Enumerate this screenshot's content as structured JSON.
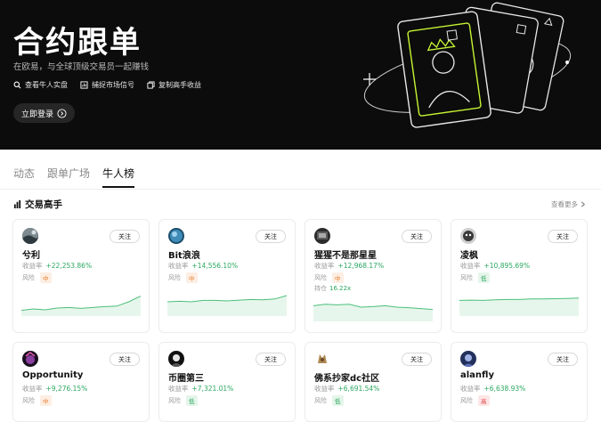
{
  "hero": {
    "title": "合约跟单",
    "subtitle": "在欧易，与全球顶级交易员一起赚钱",
    "features": [
      {
        "label": "查看牛人实盘",
        "icon": "search-icon"
      },
      {
        "label": "捕捉市场信号",
        "icon": "signal-icon"
      },
      {
        "label": "复制高手收益",
        "icon": "copy-icon"
      }
    ],
    "login_label": "立即登录",
    "bg_color": "#0c0c0c",
    "accent_color": "#c6f432"
  },
  "tabs": [
    {
      "label": "动态",
      "active": false
    },
    {
      "label": "跟单广场",
      "active": false
    },
    {
      "label": "牛人榜",
      "active": true
    }
  ],
  "section": {
    "title": "交易高手",
    "more_label": "查看更多"
  },
  "cards": [
    {
      "name": "兮利",
      "yield_label": "收益率",
      "yield": "+22,253.86%",
      "risk_label": "风险",
      "risk": "中",
      "risk_level": "mid",
      "follow_label": "关注",
      "avatar": "avatar-image",
      "trend": [
        0.2,
        0.25,
        0.22,
        0.28,
        0.3,
        0.27,
        0.3,
        0.33,
        0.35,
        0.5,
        0.7
      ]
    },
    {
      "name": "Bit浪浪",
      "yield_label": "收益率",
      "yield": "+14,556.10%",
      "risk_label": "风险",
      "risk": "中",
      "risk_level": "mid",
      "follow_label": "关注",
      "avatar": "avatar-image",
      "trend": [
        0.5,
        0.52,
        0.5,
        0.55,
        0.55,
        0.53,
        0.56,
        0.58,
        0.57,
        0.6,
        0.72
      ]
    },
    {
      "name": "猩猩不是那星星",
      "yield_label": "收益率",
      "yield": "+12,968.17%",
      "risk_label": "风险",
      "risk": "中",
      "risk_level": "mid",
      "follow_label": "关注",
      "avatar": "avatar-image",
      "hold_label": "持仓",
      "hold_value": "16.22x",
      "trend": [
        0.55,
        0.6,
        0.58,
        0.6,
        0.5,
        0.52,
        0.55,
        0.5,
        0.48,
        0.45,
        0.42
      ]
    },
    {
      "name": "凌枫",
      "yield_label": "收益率",
      "yield": "+10,895.69%",
      "risk_label": "风险",
      "risk": "低",
      "risk_level": "low",
      "follow_label": "关注",
      "avatar": "avatar-image",
      "trend": [
        0.55,
        0.56,
        0.55,
        0.57,
        0.58,
        0.58,
        0.6,
        0.6,
        0.61,
        0.62,
        0.63
      ]
    },
    {
      "name": "Opportunity",
      "yield_label": "收益率",
      "yield": "+9,276.15%",
      "risk_label": "风险",
      "risk": "中",
      "risk_level": "mid",
      "follow_label": "关注",
      "avatar": "avatar-image"
    },
    {
      "name": "币圈第三",
      "yield_label": "收益率",
      "yield": "+7,321.01%",
      "risk_label": "风险",
      "risk": "低",
      "risk_level": "low",
      "follow_label": "关注",
      "avatar": "avatar-image"
    },
    {
      "name": "佛系抄家dc社区",
      "yield_label": "收益率",
      "yield": "+6,691.54%",
      "risk_label": "风险",
      "risk": "低",
      "risk_level": "low",
      "follow_label": "关注",
      "avatar": "avatar-image"
    },
    {
      "name": "alanfly",
      "yield_label": "收益率",
      "yield": "+6,638.93%",
      "risk_label": "风险",
      "risk": "高",
      "risk_level": "high",
      "follow_label": "关注",
      "avatar": "avatar-image"
    }
  ]
}
